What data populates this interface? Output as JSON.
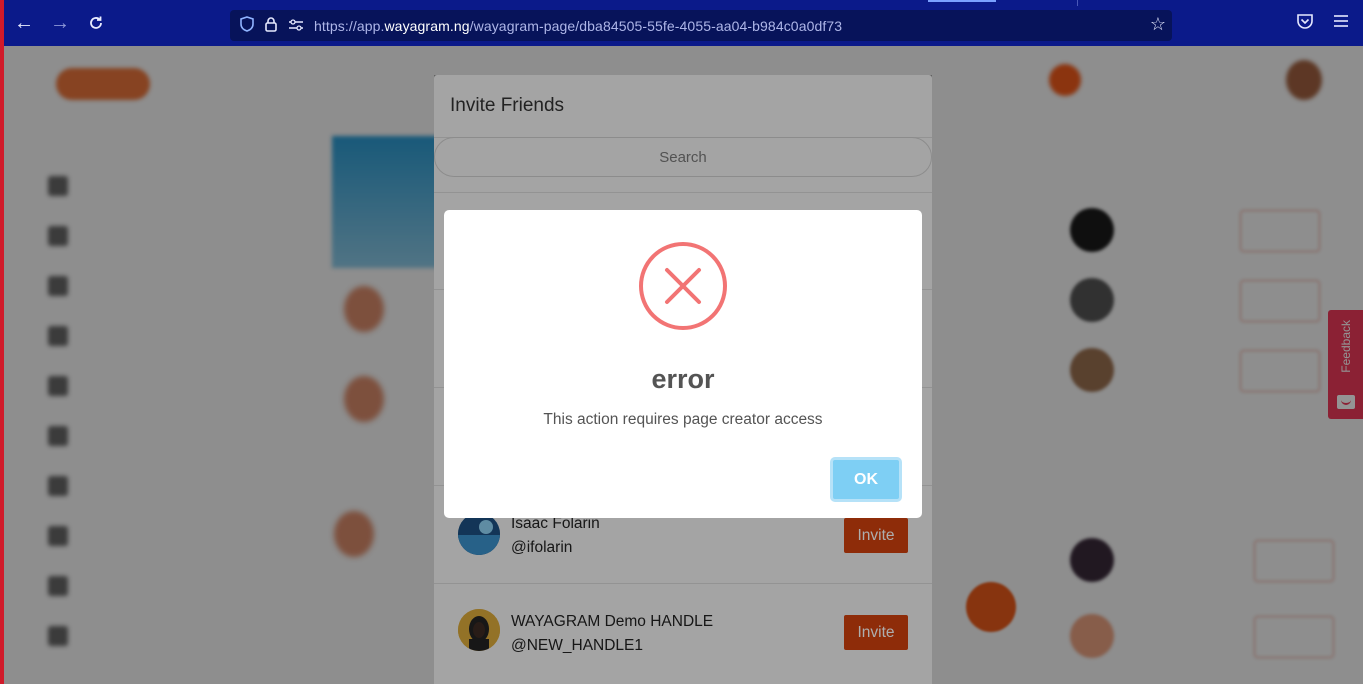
{
  "browser": {
    "url_prefix": "https://app.",
    "url_domain": "wayagram.ng",
    "url_path": "/wayagram-page/dba84505-55fe-4055-aa04-b984c0a0df73"
  },
  "feedback": {
    "label": "Feedback"
  },
  "invite_modal": {
    "title": "Invite Friends",
    "search_placeholder": "Search",
    "friends": [
      {
        "name": "Isaac Folarin",
        "handle": "@ifolarin",
        "button": "Invite"
      },
      {
        "name": "WAYAGRAM Demo HANDLE",
        "handle": "@NEW_HANDLE1",
        "button": "Invite"
      }
    ]
  },
  "error_dialog": {
    "icon": "error-x-icon",
    "title": "error",
    "message": "This action requires page creator access",
    "ok_label": "OK"
  },
  "colors": {
    "browser_bar": "#0b1a8a",
    "invite_button": "#d2410e",
    "error_icon": "#f27474",
    "ok_button": "#7ecff4",
    "feedback_tab": "#f0395a"
  }
}
